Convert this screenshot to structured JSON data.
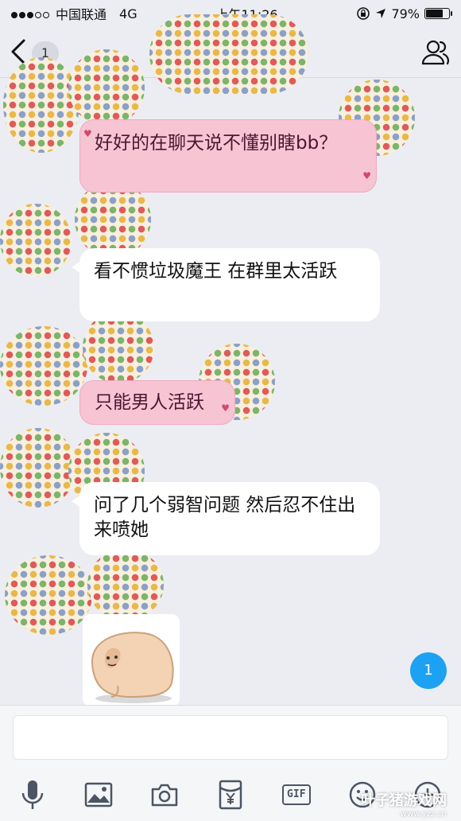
{
  "status_bar": {
    "carrier": "中国联通",
    "network": "4G",
    "time": "上午11:26",
    "battery": "79%",
    "battery_level": 0.79
  },
  "nav": {
    "unread_count": "1",
    "back_icon": "chevron-left-icon",
    "profile_icon": "group-profile-icon"
  },
  "messages": [
    {
      "type": "text",
      "style": "pink",
      "text": "好好的在聊天说不懂别瞎bb？"
    },
    {
      "type": "text",
      "style": "white",
      "text": "看不惯垃圾魔王 在群里太活跃"
    },
    {
      "type": "text",
      "style": "pink",
      "text": "只能男人活跃"
    },
    {
      "type": "text",
      "style": "white",
      "text": "问了几个弱智问题 然后忍不住出来喷她"
    },
    {
      "type": "sticker",
      "name": "blob-face-sticker"
    }
  ],
  "new_message_badge": "1",
  "input": {
    "value": "",
    "placeholder": ""
  },
  "toolbar": [
    {
      "name": "microphone-icon"
    },
    {
      "name": "image-icon"
    },
    {
      "name": "camera-icon"
    },
    {
      "name": "red-packet-icon"
    },
    {
      "name": "gif-icon",
      "label": "GIF"
    },
    {
      "name": "emoji-icon"
    },
    {
      "name": "plus-icon"
    }
  ],
  "watermark": {
    "main": "叶子猪游戏网",
    "sub": "www.yzz.cn"
  },
  "colors": {
    "accent": "#1da1f2",
    "pink_bubble": "#f7c4d4",
    "background": "#ebedf2"
  }
}
